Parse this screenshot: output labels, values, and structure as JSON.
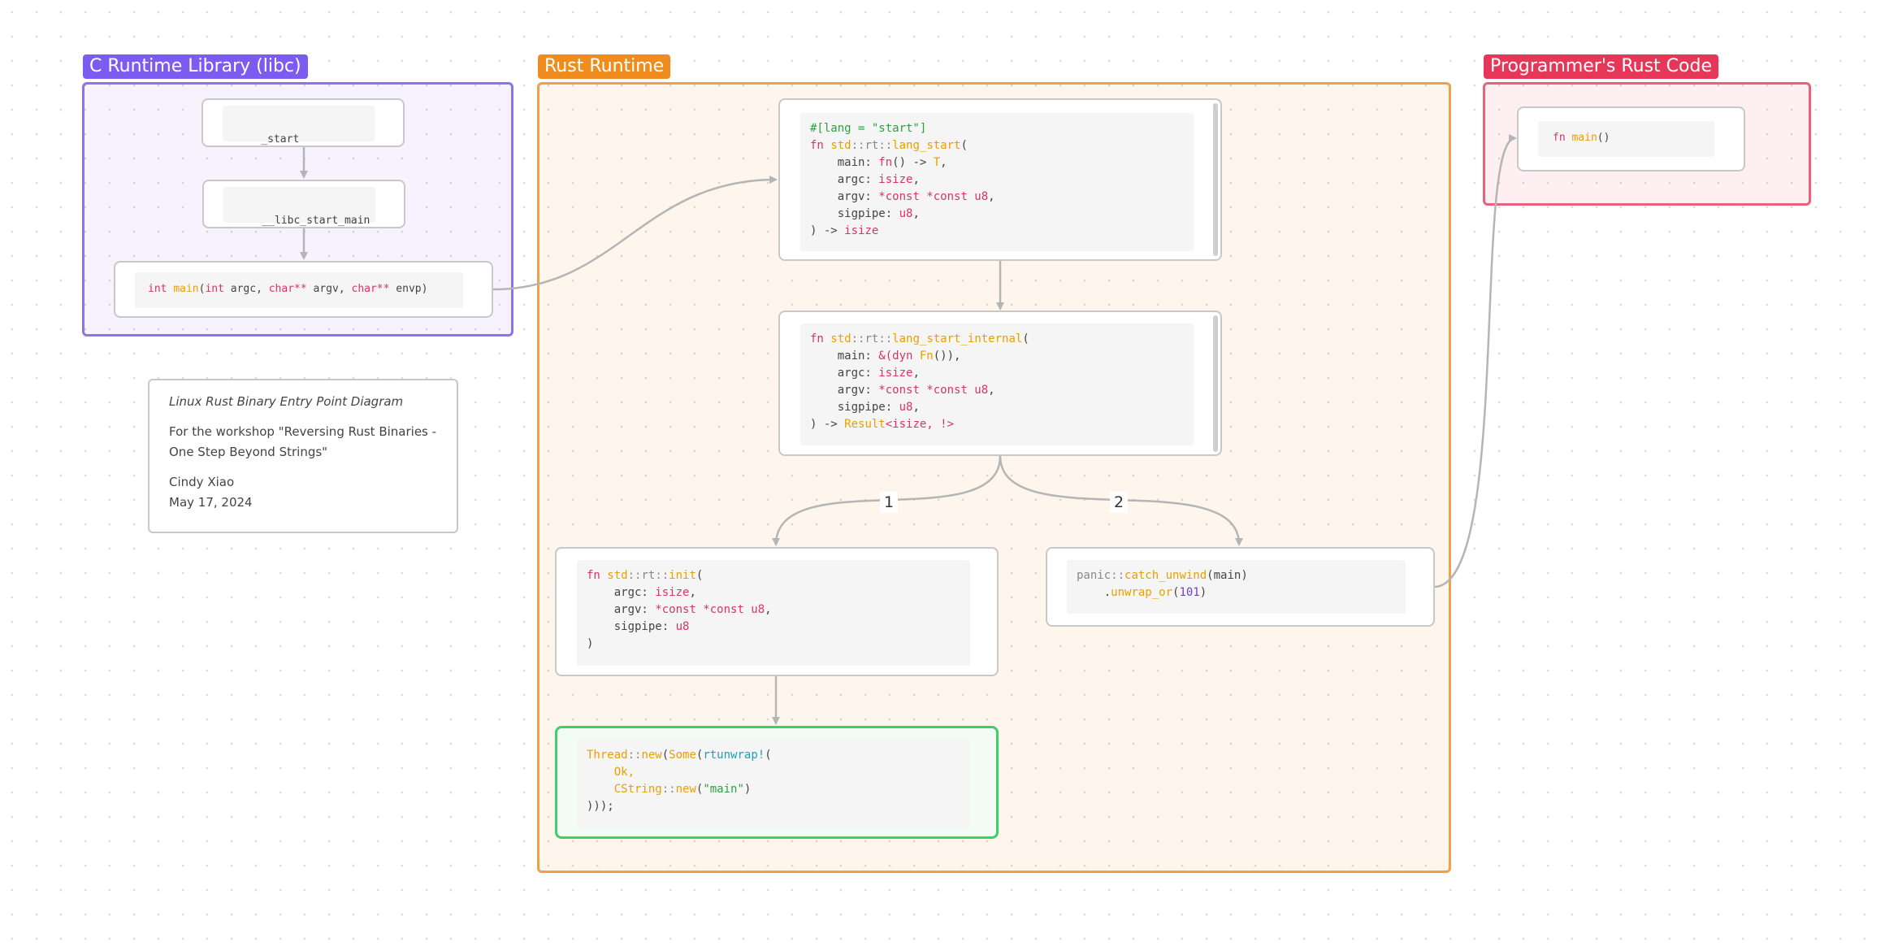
{
  "groups": {
    "libc": {
      "label": "C Runtime Library (libc)",
      "color": "#7c5cf0"
    },
    "rust_runtime": {
      "label": "Rust Runtime",
      "color": "#f08c1e"
    },
    "programmer": {
      "label": "Programmer's Rust Code",
      "color": "#e63758"
    }
  },
  "nodes": {
    "start": "_start",
    "libc_start_main": "__libc_start_main",
    "c_main": {
      "t1": "int",
      "t2": "main",
      "t3": "(",
      "t4": "int",
      "t5": " argc, ",
      "t6": "char**",
      "t7": " argv, ",
      "t8": "char**",
      "t9": " envp)"
    },
    "lang_start": {
      "l1": "#[lang = \"start\"]",
      "l2_fn": "fn ",
      "l2_ns": "std",
      "l2_sep1": "::",
      "l2_rt": "rt",
      "l2_sep2": "::",
      "l2_name": "lang_start",
      "l2_paren": "(",
      "l3_a": "    main: ",
      "l3_b": "fn",
      "l3_c": "() -> ",
      "l3_d": "T",
      "l3_e": ",",
      "l4_a": "    argc: ",
      "l4_b": "isize",
      "l4_c": ",",
      "l5_a": "    argv: ",
      "l5_b": "*const *const u8",
      "l5_c": ",",
      "l6_a": "    sigpipe: ",
      "l6_b": "u8",
      "l6_c": ",",
      "l7_a": ") -> ",
      "l7_b": "isize"
    },
    "lang_start_internal": {
      "l1_fn": "fn ",
      "l1_ns": "std",
      "l1_sep1": "::",
      "l1_rt": "rt",
      "l1_sep2": "::",
      "l1_name": "lang_start_internal",
      "l1_paren": "(",
      "l2_a": "    main: ",
      "l2_b": "&(dyn ",
      "l2_c": "Fn",
      "l2_d": "()),",
      "l3_a": "    argc: ",
      "l3_b": "isize",
      "l3_c": ",",
      "l4_a": "    argv: ",
      "l4_b": "*const *const u8",
      "l4_c": ",",
      "l5_a": "    sigpipe: ",
      "l5_b": "u8",
      "l5_c": ",",
      "l6_a": ") -> ",
      "l6_b": "Result",
      "l6_c": "<isize, ",
      "l6_d": "!>"
    },
    "rt_init": {
      "l1_fn": "fn ",
      "l1_ns": "std",
      "l1_sep1": "::",
      "l1_rt": "rt",
      "l1_sep2": "::",
      "l1_name": "init",
      "l1_paren": "(",
      "l2_a": "    argc: ",
      "l2_b": "isize",
      "l2_c": ",",
      "l3_a": "    argv: ",
      "l3_b": "*const *const u8",
      "l3_c": ",",
      "l4_a": "    sigpipe: ",
      "l4_b": "u8",
      "l5": ")"
    },
    "thread_new": {
      "l1_a": "Thread",
      "l1_b": "::",
      "l1_c": "new",
      "l1_d": "(",
      "l1_e": "Some",
      "l1_f": "(",
      "l1_g": "rtunwrap!",
      "l1_h": "(",
      "l2": "    Ok,",
      "l3_a": "    ",
      "l3_b": "CString",
      "l3_c": "::",
      "l3_d": "new",
      "l3_e": "(",
      "l3_f": "\"main\"",
      "l3_g": ")",
      "l4": ")));"
    },
    "catch_unwind": {
      "l1_a": "panic",
      "l1_b": "::",
      "l1_c": "catch_unwind",
      "l1_d": "(main)",
      "l2_a": "    .",
      "l2_b": "unwrap_or",
      "l2_c": "(",
      "l2_d": "101",
      "l2_e": ")"
    },
    "fn_main": {
      "kw": "fn ",
      "name": "main",
      "paren": "()"
    }
  },
  "edge_labels": {
    "one": "1",
    "two": "2"
  },
  "note": {
    "title": "Linux Rust Binary Entry Point Diagram",
    "line1": "For the workshop \"Reversing Rust Binaries -",
    "line2": "One Step Beyond Strings\"",
    "author": "Cindy Xiao",
    "date": "May 17, 2024"
  }
}
